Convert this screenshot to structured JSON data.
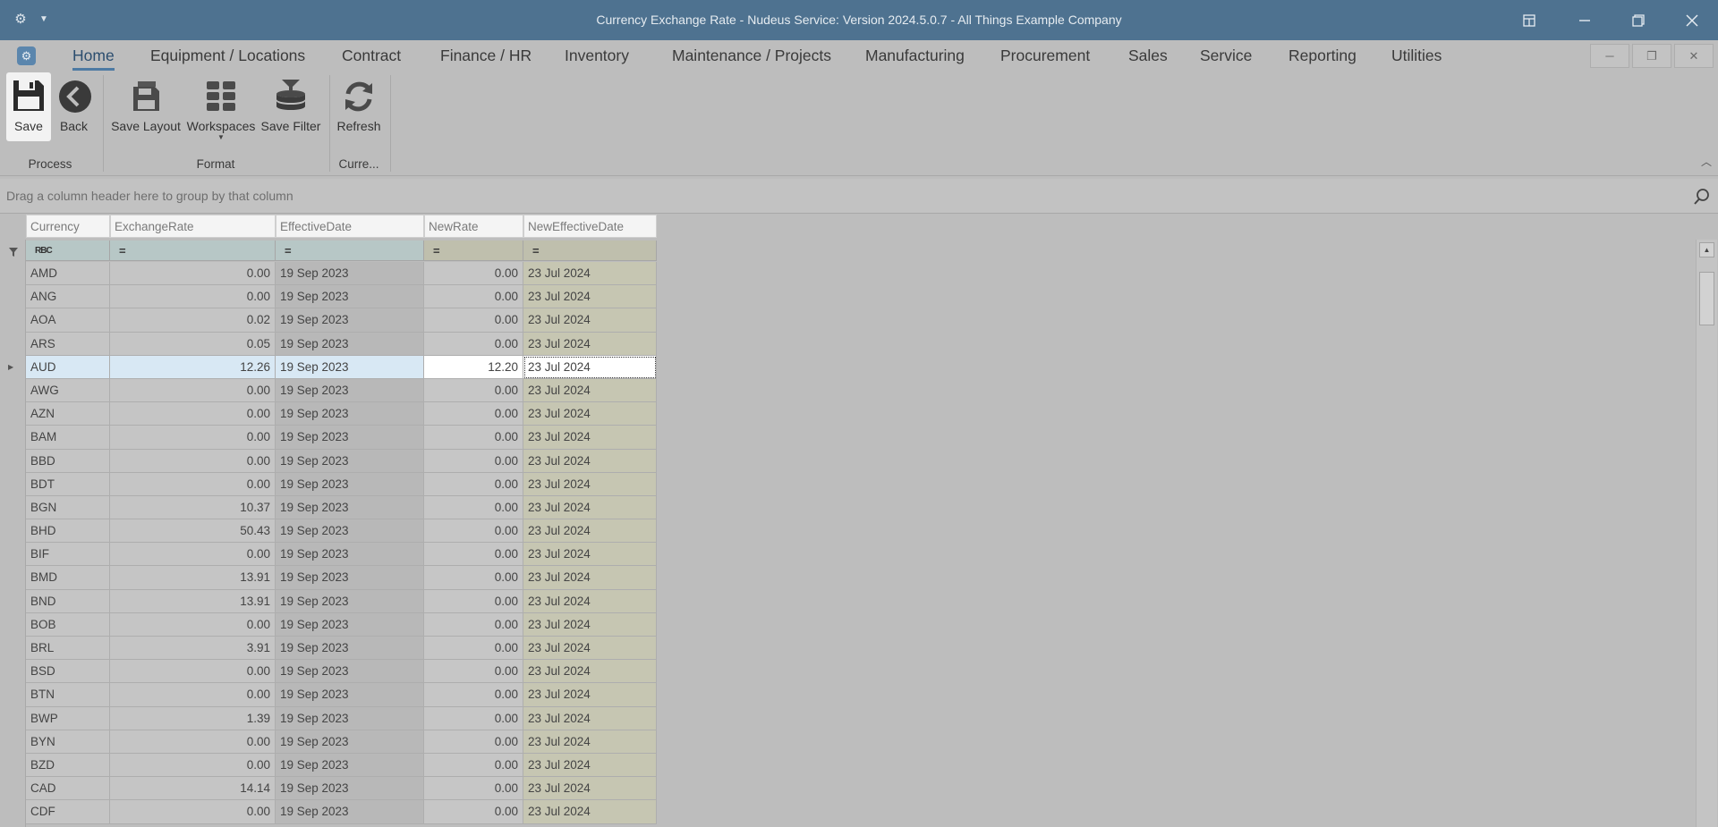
{
  "window": {
    "title": "Currency Exchange Rate - Nudeus Service: Version 2024.5.0.7 - All Things Example Company",
    "icons": [
      "gear-icon",
      "chevron-down-icon",
      "layout-icon",
      "minimize-icon",
      "restore-icon",
      "close-icon"
    ]
  },
  "menu": {
    "tabs": [
      "Home",
      "Equipment / Locations",
      "Contract",
      "Finance / HR",
      "Inventory",
      "Maintenance / Projects",
      "Manufacturing",
      "Procurement",
      "Sales",
      "Service",
      "Reporting",
      "Utilities"
    ],
    "active": "Home"
  },
  "ribbon": {
    "buttons": {
      "save": "Save",
      "back": "Back",
      "save_layout": "Save Layout",
      "workspaces": "Workspaces",
      "save_filter": "Save Filter",
      "refresh": "Refresh"
    },
    "groups": {
      "process": "Process",
      "format": "Format",
      "current": "Curre..."
    }
  },
  "group_panel": {
    "hint": "Drag a column header here to group by that column"
  },
  "grid": {
    "columns": [
      "Currency",
      "ExchangeRate",
      "EffectiveDate",
      "NewRate",
      "NewEffectiveDate"
    ],
    "filter_ops": [
      "RBC",
      "=",
      "=",
      "=",
      "="
    ],
    "focused_row": 4,
    "rows": [
      [
        "AMD",
        "0.00",
        "19 Sep 2023",
        "0.00",
        "23 Jul 2024"
      ],
      [
        "ANG",
        "0.00",
        "19 Sep 2023",
        "0.00",
        "23 Jul 2024"
      ],
      [
        "AOA",
        "0.02",
        "19 Sep 2023",
        "0.00",
        "23 Jul 2024"
      ],
      [
        "ARS",
        "0.05",
        "19 Sep 2023",
        "0.00",
        "23 Jul 2024"
      ],
      [
        "AUD",
        "12.26",
        "19 Sep 2023",
        "12.20",
        "23 Jul 2024"
      ],
      [
        "AWG",
        "0.00",
        "19 Sep 2023",
        "0.00",
        "23 Jul 2024"
      ],
      [
        "AZN",
        "0.00",
        "19 Sep 2023",
        "0.00",
        "23 Jul 2024"
      ],
      [
        "BAM",
        "0.00",
        "19 Sep 2023",
        "0.00",
        "23 Jul 2024"
      ],
      [
        "BBD",
        "0.00",
        "19 Sep 2023",
        "0.00",
        "23 Jul 2024"
      ],
      [
        "BDT",
        "0.00",
        "19 Sep 2023",
        "0.00",
        "23 Jul 2024"
      ],
      [
        "BGN",
        "10.37",
        "19 Sep 2023",
        "0.00",
        "23 Jul 2024"
      ],
      [
        "BHD",
        "50.43",
        "19 Sep 2023",
        "0.00",
        "23 Jul 2024"
      ],
      [
        "BIF",
        "0.00",
        "19 Sep 2023",
        "0.00",
        "23 Jul 2024"
      ],
      [
        "BMD",
        "13.91",
        "19 Sep 2023",
        "0.00",
        "23 Jul 2024"
      ],
      [
        "BND",
        "13.91",
        "19 Sep 2023",
        "0.00",
        "23 Jul 2024"
      ],
      [
        "BOB",
        "0.00",
        "19 Sep 2023",
        "0.00",
        "23 Jul 2024"
      ],
      [
        "BRL",
        "3.91",
        "19 Sep 2023",
        "0.00",
        "23 Jul 2024"
      ],
      [
        "BSD",
        "0.00",
        "19 Sep 2023",
        "0.00",
        "23 Jul 2024"
      ],
      [
        "BTN",
        "0.00",
        "19 Sep 2023",
        "0.00",
        "23 Jul 2024"
      ],
      [
        "BWP",
        "1.39",
        "19 Sep 2023",
        "0.00",
        "23 Jul 2024"
      ],
      [
        "BYN",
        "0.00",
        "19 Sep 2023",
        "0.00",
        "23 Jul 2024"
      ],
      [
        "BZD",
        "0.00",
        "19 Sep 2023",
        "0.00",
        "23 Jul 2024"
      ],
      [
        "CAD",
        "14.14",
        "19 Sep 2023",
        "0.00",
        "23 Jul 2024"
      ],
      [
        "CDF",
        "0.00",
        "19 Sep 2023",
        "0.00",
        "23 Jul 2024"
      ]
    ]
  }
}
